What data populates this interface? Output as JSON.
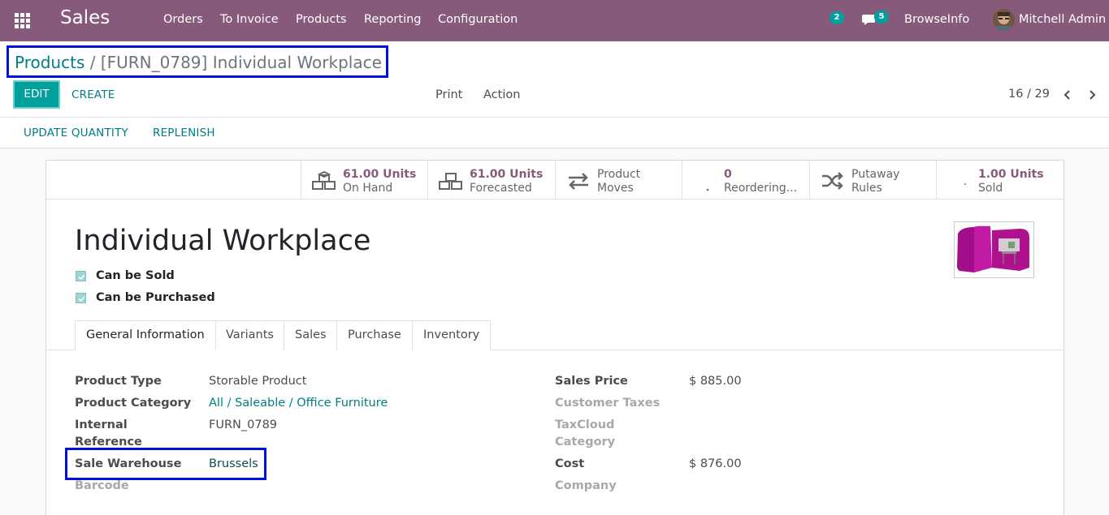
{
  "navbar": {
    "brand": "Sales",
    "menu": [
      "Orders",
      "To Invoice",
      "Products",
      "Reporting",
      "Configuration"
    ],
    "activity_count": "2",
    "message_count": "5",
    "company": "BrowseInfo",
    "user": "Mitchell Admin"
  },
  "breadcrumb": {
    "parent": "Products",
    "separator": "/",
    "current": "[FURN_0789] Individual Workplace"
  },
  "control_panel": {
    "edit_label": "EDIT",
    "create_label": "CREATE",
    "print_label": "Print",
    "action_label": "Action",
    "pager": "16 / 29"
  },
  "header_buttons": {
    "update_quantity": "UPDATE QUANTITY",
    "replenish": "REPLENISH"
  },
  "smart_buttons": [
    {
      "value": "61.00 Units",
      "label": "On Hand",
      "icon": "cubes-icon"
    },
    {
      "value": "61.00 Units",
      "label": "Forecasted",
      "icon": "cubes-icon"
    },
    {
      "value": "Product",
      "label": "Moves",
      "icon": "exchange-icon"
    },
    {
      "value": "0",
      "label": "Reordering...",
      "icon": "refresh-icon"
    },
    {
      "value": "Putaway",
      "label": "Rules",
      "icon": "random-icon"
    },
    {
      "value": "1.00 Units",
      "label": "Sold",
      "icon": "signal-icon"
    }
  ],
  "product": {
    "name": "Individual Workplace",
    "can_be_sold": "Can be Sold",
    "can_be_purchased": "Can be Purchased"
  },
  "tabs": [
    "General Information",
    "Variants",
    "Sales",
    "Purchase",
    "Inventory"
  ],
  "fields_left": {
    "product_type_label": "Product Type",
    "product_type": "Storable Product",
    "category_label": "Product Category",
    "category": "All / Saleable / Office Furniture",
    "internal_ref_label_1": "Internal",
    "internal_ref_label_2": "Reference",
    "internal_ref": "FURN_0789",
    "warehouse_label": "Sale Warehouse",
    "warehouse": "Brussels",
    "barcode_label": "Barcode"
  },
  "fields_right": {
    "sales_price_label": "Sales Price",
    "sales_price": "$ 885.00",
    "customer_taxes_label": "Customer Taxes",
    "taxcloud_label_1": "TaxCloud",
    "taxcloud_label_2": "Category",
    "cost_label": "Cost",
    "cost": "$ 876.00",
    "company_label": "Company"
  },
  "colors": {
    "navbar": "#875a7b",
    "primary": "#00a09d",
    "link": "#017e84",
    "highlight_box": "#0011dd"
  }
}
